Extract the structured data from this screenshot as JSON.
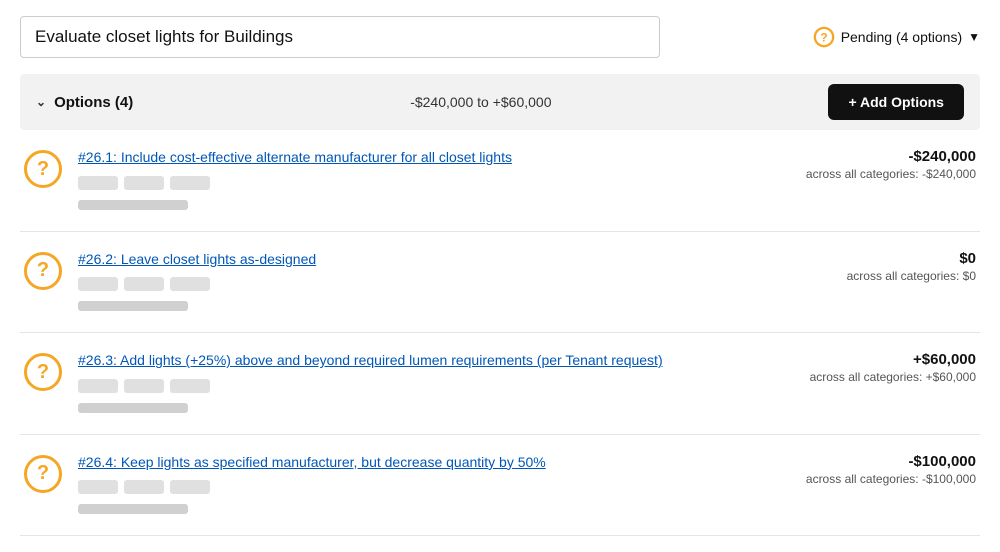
{
  "header": {
    "title": "Evaluate closet lights for Buildings",
    "pending_label": "Pending (4 options)",
    "pending_icon": "question-icon"
  },
  "options_bar": {
    "collapse_icon": "chevron-down",
    "label": "Options (4)",
    "range": "-$240,000 to +$60,000",
    "add_button_label": "+ Add Options"
  },
  "options": [
    {
      "id": "opt-1",
      "icon": "question-circle-icon",
      "title": "#26.1: Include cost-effective alternate manufacturer for all closet lights",
      "amount_main": "-$240,000",
      "amount_sub": "across all categories: -$240,000",
      "amount_class": "negative"
    },
    {
      "id": "opt-2",
      "icon": "question-circle-icon",
      "title": "#26.2: Leave closet lights as-designed",
      "amount_main": "$0",
      "amount_sub": "across all categories: $0",
      "amount_class": "zero"
    },
    {
      "id": "opt-3",
      "icon": "question-circle-icon",
      "title": "#26.3: Add lights (+25%) above and beyond required lumen requirements (per Tenant request)",
      "amount_main": "+$60,000",
      "amount_sub": "across all categories: +$60,000",
      "amount_class": "positive"
    },
    {
      "id": "opt-4",
      "icon": "question-circle-icon",
      "title": "#26.4: Keep lights as specified manufacturer, but decrease quantity by 50%",
      "amount_main": "-$100,000",
      "amount_sub": "across all categories: -$100,000",
      "amount_class": "negative"
    }
  ]
}
